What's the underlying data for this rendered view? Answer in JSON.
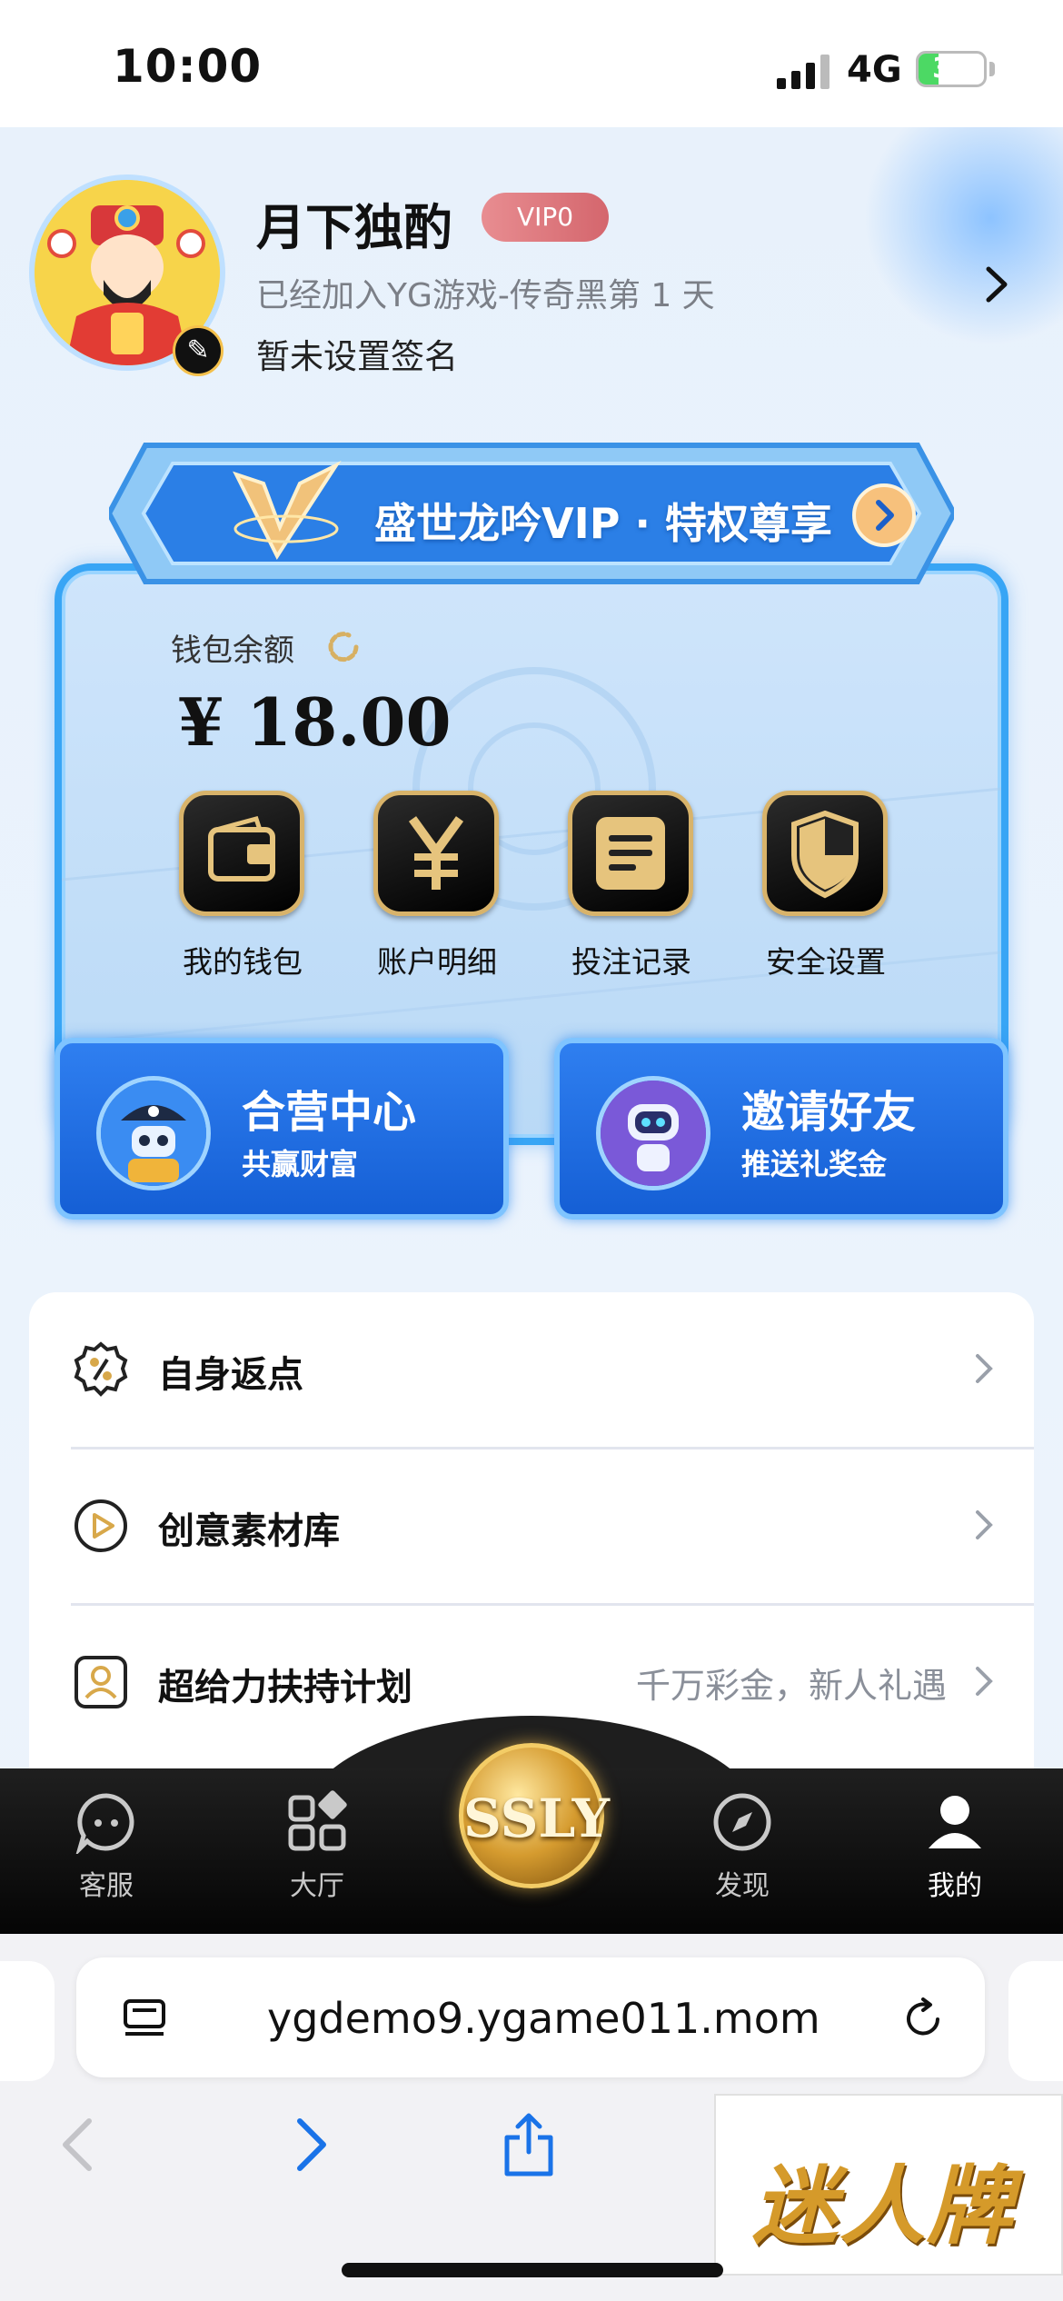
{
  "status_bar": {
    "time": "10:00",
    "network": "4G",
    "battery": "30",
    "battery_level": 0.3
  },
  "profile": {
    "name": "月下独酌",
    "vip_level": "VIP0",
    "join_text": "已经加入YG游戏-传奇黑第 1 天",
    "signature": "暂未设置签名"
  },
  "vip_card": {
    "banner_text": "盛世龙吟VIP · 特权尊享",
    "wallet_label": "钱包余额",
    "wallet_amount": "¥ 18.00",
    "actions": [
      {
        "label": "我的钱包",
        "icon": "wallet-icon"
      },
      {
        "label": "账户明细",
        "icon": "yuan-icon"
      },
      {
        "label": "投注记录",
        "icon": "document-icon"
      },
      {
        "label": "安全设置",
        "icon": "shield-icon"
      }
    ]
  },
  "promos": [
    {
      "title": "合营中心",
      "subtitle": "共赢财富"
    },
    {
      "title": "邀请好友",
      "subtitle": "推送礼奖金"
    }
  ],
  "menu": [
    {
      "label": "自身返点",
      "extra": "",
      "icon": "percent-badge-icon"
    },
    {
      "label": "创意素材库",
      "extra": "",
      "icon": "play-icon"
    },
    {
      "label": "超给力扶持计划",
      "extra": "千万彩金，新人礼遇",
      "icon": "user-card-icon"
    }
  ],
  "tabbar": {
    "tabs": [
      {
        "label": "客服",
        "icon": "chat-icon",
        "active": false
      },
      {
        "label": "大厅",
        "icon": "grid-icon",
        "active": false
      },
      {
        "label": "发现",
        "icon": "compass-icon",
        "active": false
      },
      {
        "label": "我的",
        "icon": "person-icon",
        "active": true
      }
    ],
    "center_logo": "SSLY"
  },
  "browser": {
    "url": "ygdemo9.ygame011.mom"
  },
  "watermark": "迷人牌",
  "colors": {
    "accent_blue": "#2f7ff0",
    "gold": "#d8b36a",
    "vip_badge": "#d4666d",
    "battery_green": "#4cd964"
  }
}
